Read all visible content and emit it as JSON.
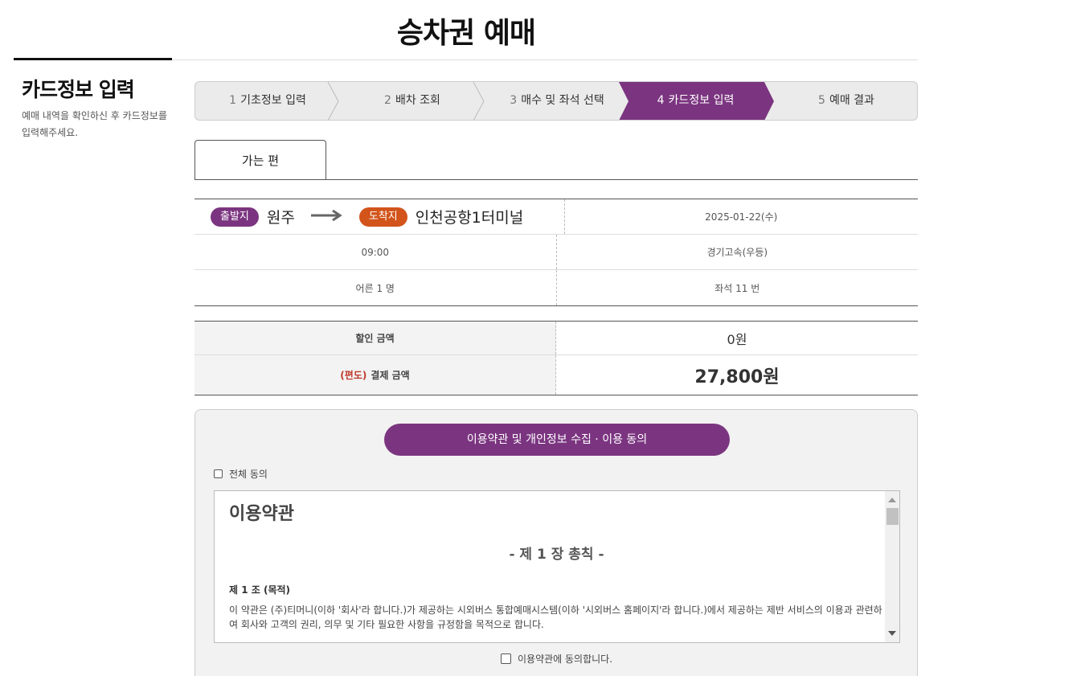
{
  "page": {
    "title": "승차권 예매"
  },
  "side": {
    "title": "카드정보 입력",
    "desc": "예매 내역을 확인하신 후 카드정보를 입력해주세요."
  },
  "steps": [
    {
      "num": "1",
      "label": "기초정보 입력",
      "active": false
    },
    {
      "num": "2",
      "label": "배차 조회",
      "active": false
    },
    {
      "num": "3",
      "label": "매수 및 좌석 선택",
      "active": false
    },
    {
      "num": "4",
      "label": "카드정보 입력",
      "active": true
    },
    {
      "num": "5",
      "label": "예매 결과",
      "active": false
    }
  ],
  "colors": {
    "accent": "#7b3580",
    "arrival": "#d2541b",
    "discount_red": "#c0392b"
  },
  "tab": {
    "label": "가는 편"
  },
  "trip": {
    "departure_badge": "출발지",
    "departure": "원주",
    "arrival_badge": "도착지",
    "arrival": "인천공항1터미널",
    "date": "2025-01-22(수)",
    "time": "09:00",
    "company": "경기고속(우등)",
    "passengers": "어른 1 명",
    "seat": "좌석 11 번"
  },
  "price": {
    "discount_label": "할인 금액",
    "discount_value": "0원",
    "pay_prefix": "(편도)",
    "pay_label": "결제 금액",
    "pay_value": "27,800원"
  },
  "terms": {
    "button_label": "이용약관 및 개인정보 수집 · 이용 동의",
    "agree_all": "전체 동의",
    "heading": "이용약관",
    "chapter": "- 제 1 장 총칙 -",
    "article_title": "제 1 조 (목적)",
    "article_text": "이 약관은 (주)티머니(이하 '회사'라 합니다.)가 제공하는 시외버스 통합예매시스템(이하 '시외버스 홈페이지'라 합니다.)에서 제공하는 제반 서비스의 이용과 관련하여 회사와 고객의 권리, 의무 및 기타 필요한 사항을 규정함을 목적으로 합니다.",
    "agree_terms": "이용약관에 동의합니다."
  }
}
